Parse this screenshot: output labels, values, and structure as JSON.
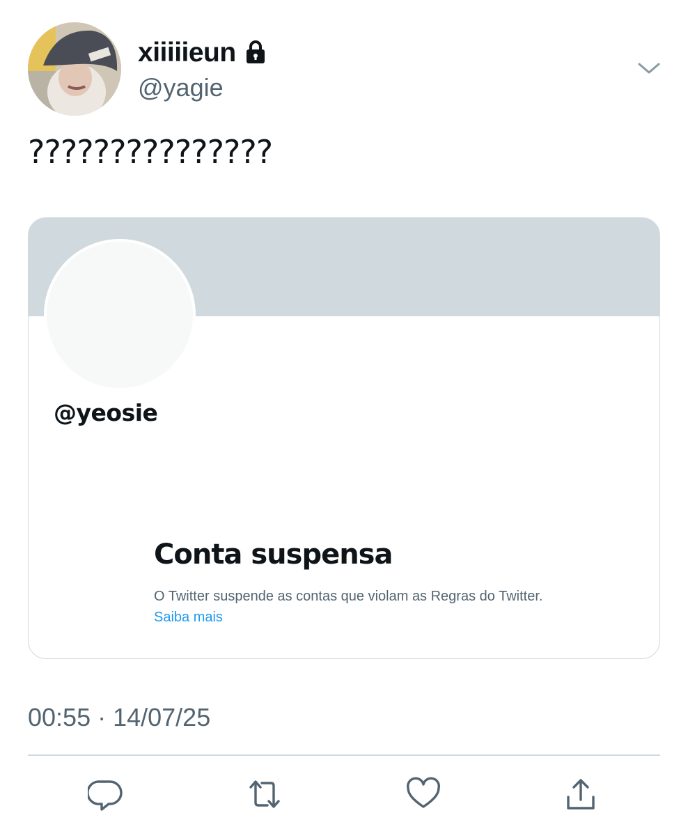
{
  "tweet": {
    "author": {
      "display_name": "xiiiiieun",
      "handle": "@yagie",
      "locked_icon": "lock-icon"
    },
    "text": "???????????????",
    "timestamp": "00:55 · 14/07/25",
    "menu_icon": "chevron-down-icon"
  },
  "card": {
    "handle": "@yeosie",
    "title": "Conta suspensa",
    "description": "O Twitter suspende as contas que violam as Regras do Twitter.",
    "link_text": "Saiba mais",
    "banner_color": "#cfd9de",
    "link_color": "#1d9bf0"
  },
  "actions": {
    "reply_icon": "reply-icon",
    "retweet_icon": "retweet-icon",
    "like_icon": "heart-icon",
    "share_icon": "share-icon"
  },
  "colors": {
    "text_primary": "#0f1419",
    "text_secondary": "#536471",
    "border": "#cfd9de"
  }
}
